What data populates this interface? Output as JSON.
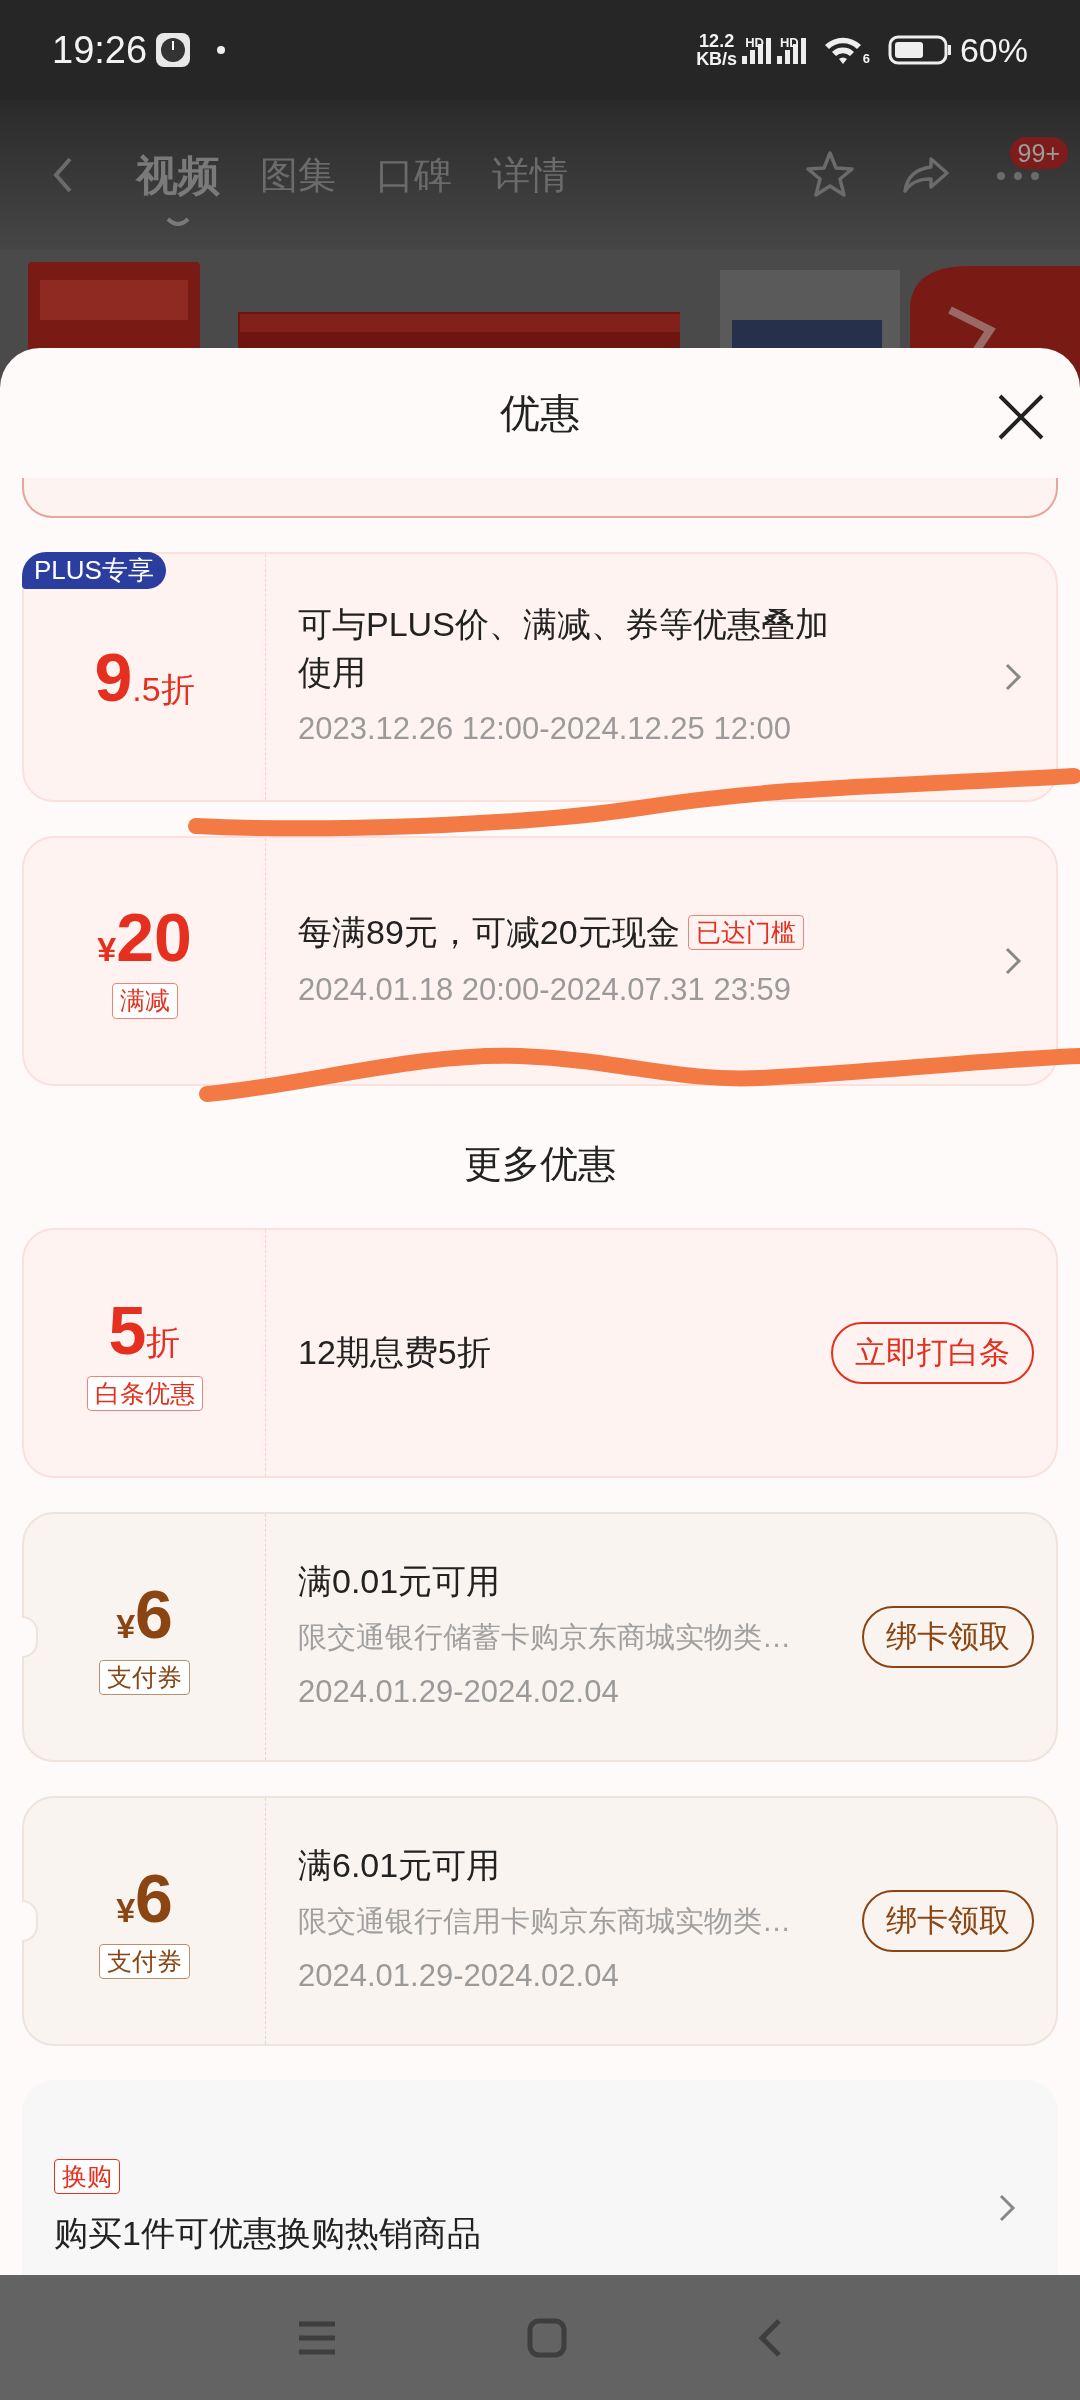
{
  "status_bar": {
    "time": "19:26",
    "net_speed": "12.2",
    "net_unit": "KB/s",
    "signal_labels": [
      "HD",
      "HD"
    ],
    "wifi_label": "6",
    "battery": "60%"
  },
  "header": {
    "tabs": [
      {
        "label": "视频",
        "selected": true
      },
      {
        "label": "图集",
        "selected": false
      },
      {
        "label": "口碑",
        "selected": false
      },
      {
        "label": "详情",
        "selected": false
      }
    ],
    "more_badge": "99+"
  },
  "sheet": {
    "title": "优惠"
  },
  "offers": [
    {
      "kind": "discount",
      "color": "#e5301f",
      "badge": "PLUS专享",
      "value": "9",
      "value_suffix": ".5折",
      "title": "可与PLUS价、满减、券等优惠叠加使用",
      "date": "2023.12.26 12:00-2024.12.25 12:00",
      "pen_underline": true
    },
    {
      "kind": "amount",
      "color": "#e5301f",
      "currency": "¥",
      "value": "20",
      "tag": "满减",
      "title": "每满89元，可减20元现金",
      "title_tag": "已达门槛",
      "date": "2024.01.18 20:00-2024.07.31 23:59",
      "pen_underline": true
    }
  ],
  "more_title": "更多优惠",
  "more_offers": [
    {
      "kind": "discount",
      "color": "#e5301f",
      "value": "5",
      "value_suffix": "折",
      "tag": "白条优惠",
      "title": "12期息费5折",
      "button": "立即打白条"
    },
    {
      "kind": "amount",
      "color": "#8b4513",
      "notched": true,
      "currency": "¥",
      "value": "6",
      "tag": "支付券",
      "title": "满0.01元可用",
      "desc": "限交通银行储蓄卡购京东商城实物类…",
      "date": "2024.01.29-2024.02.04",
      "button": "绑卡领取"
    },
    {
      "kind": "amount",
      "color": "#8b4513",
      "notched": true,
      "currency": "¥",
      "value": "6",
      "tag": "支付券",
      "title": "满6.01元可用",
      "desc": "限交通银行信用卡购京东商城实物类…",
      "date": "2024.01.29-2024.02.04",
      "button": "绑卡领取"
    },
    {
      "kind": "swap",
      "color": "#e5301f",
      "tag": "换购",
      "title": "购买1件可优惠换购热销商品"
    }
  ]
}
